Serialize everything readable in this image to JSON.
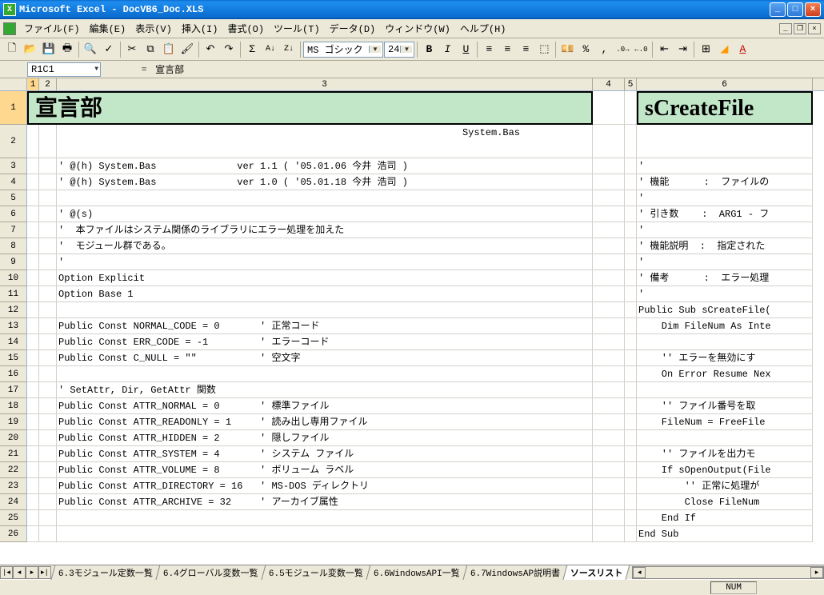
{
  "window": {
    "title": "Microsoft Excel - DocVB6_Doc.XLS"
  },
  "menu": {
    "file": "ファイル(F)",
    "edit": "編集(E)",
    "view": "表示(V)",
    "insert": "挿入(I)",
    "format": "書式(O)",
    "tools": "ツール(T)",
    "data": "データ(D)",
    "window": "ウィンドウ(W)",
    "help": "ヘルプ(H)"
  },
  "toolbar": {
    "font_name": "MS ゴシック",
    "font_size": "24"
  },
  "formula": {
    "name_box": "R1C1",
    "fx": "=",
    "value": "宣言部"
  },
  "columns": [
    "1",
    "2",
    "3",
    "4",
    "5",
    "6"
  ],
  "rows": {
    "r1_left_merge": "宣言部",
    "r1_right_merge": "sCreateFile",
    "r2_right_c4": "System.Bas",
    "r3": "' @(h) System.Bas              ver 1.1 ( '05.01.06 今井 浩司 )",
    "r3r": "'",
    "r4": "' @(h) System.Bas              ver 1.0 ( '05.01.18 今井 浩司 )",
    "r4r": "' 機能      :  ファイルの",
    "r5r": "'",
    "r6": "' @(s)",
    "r6r": "' 引き数    :  ARG1 - フ",
    "r7": "'  本ファイルはシステム関係のライブラリにエラー処理を加えた",
    "r7r": "'",
    "r8": "'  モジュール群である。",
    "r8r": "' 機能説明  :  指定された",
    "r9": "'",
    "r9r": "'",
    "r10": "Option Explicit",
    "r10r": "' 備考      :  エラー処理",
    "r11": "Option Base 1",
    "r11r": "'",
    "r12r": "Public Sub sCreateFile(",
    "r13": "Public Const NORMAL_CODE = 0       ' 正常コード",
    "r13r": "    Dim FileNum As Inte",
    "r14": "Public Const ERR_CODE = -1         ' エラーコード",
    "r15": "Public Const C_NULL = \"\"           ' 空文字",
    "r15r": "    '' エラーを無効にす",
    "r16r": "    On Error Resume Nex",
    "r17": "' SetAttr, Dir, GetAttr 関数",
    "r18": "Public Const ATTR_NORMAL = 0       ' 標準ファイル",
    "r18r": "    '' ファイル番号を取",
    "r19": "Public Const ATTR_READONLY = 1     ' 読み出し専用ファイル",
    "r19r": "    FileNum = FreeFile",
    "r20": "Public Const ATTR_HIDDEN = 2       ' 隠しファイル",
    "r21": "Public Const ATTR_SYSTEM = 4       ' システム ファイル",
    "r21r": "    '' ファイルを出力モ",
    "r22": "Public Const ATTR_VOLUME = 8       ' ボリューム ラベル",
    "r22r": "    If sOpenOutput(File",
    "r23": "Public Const ATTR_DIRECTORY = 16   ' MS-DOS ディレクトリ",
    "r23r": "        '' 正常に処理が",
    "r24": "Public Const ATTR_ARCHIVE = 32     ' アーカイブ属性",
    "r24r": "        Close FileNum",
    "r25r": "    End If",
    "r26r": "End Sub"
  },
  "tabs": {
    "t1": "6.3モジュール定数一覧",
    "t2": "6.4グローバル変数一覧",
    "t3": "6.5モジュール変数一覧",
    "t4": "6.6WindowsAPI一覧",
    "t5": "6.7WindowsAP説明書",
    "t6": "ソースリスト"
  },
  "status": {
    "num": "NUM"
  }
}
